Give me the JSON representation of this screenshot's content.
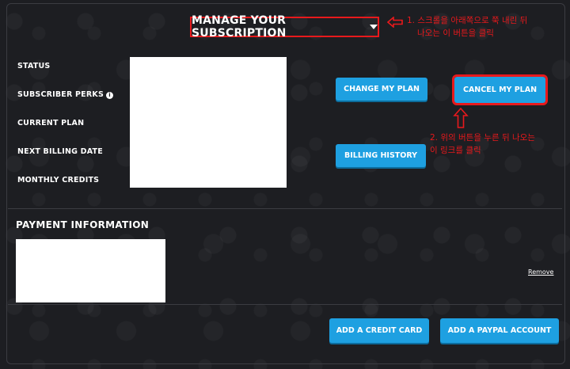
{
  "header": {
    "title": "MANAGE YOUR SUBSCRIPTION"
  },
  "subscription": {
    "labels": {
      "status": "STATUS",
      "subscriber_perks": "SUBSCRIBER PERKS",
      "current_plan": "CURRENT PLAN",
      "next_billing_date": "NEXT BILLING DATE",
      "monthly_credits": "MONTHLY CREDITS"
    },
    "buttons": {
      "change_plan": "CHANGE MY PLAN",
      "cancel_plan": "CANCEL MY PLAN",
      "billing_history": "BILLING HISTORY"
    }
  },
  "annotations": {
    "note1_line1": "1. 스크롤을 아래쪽으로 쭉 내린 뒤",
    "note1_line2": "나오는 이 버튼을 클릭",
    "note2_line1": "2. 위의 버튼을 누른 뒤 나오는",
    "note2_line2": "이 링크를 클릭"
  },
  "payment": {
    "title": "PAYMENT INFORMATION",
    "remove_label": "Remove",
    "add_credit_card": "ADD A CREDIT CARD",
    "add_paypal": "ADD A PAYPAL ACCOUNT"
  },
  "colors": {
    "accent_button": "#1ea0e1",
    "annotation_red": "#e8191c",
    "background": "#1d1e22"
  }
}
